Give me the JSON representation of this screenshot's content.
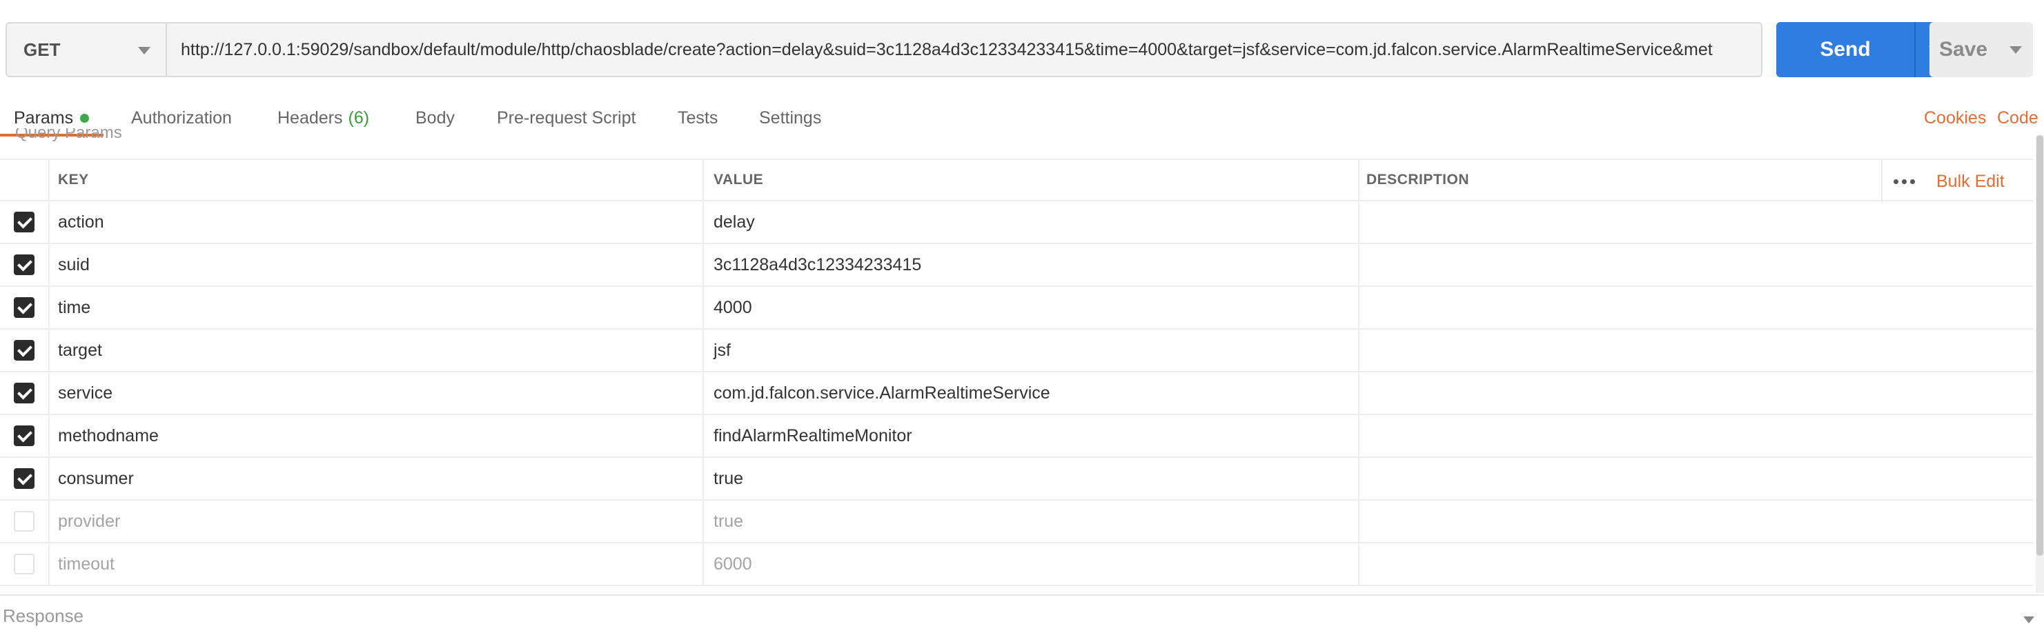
{
  "request": {
    "method": "GET",
    "url": "http://127.0.0.1:59029/sandbox/default/module/http/chaosblade/create?action=delay&suid=3c1128a4d3c12334233415&time=4000&target=jsf&service=com.jd.falcon.service.AlarmRealtimeService&met",
    "send_label": "Send",
    "save_label": "Save"
  },
  "tabs": [
    {
      "label": "Params"
    },
    {
      "label": "Authorization"
    },
    {
      "label": "Headers",
      "count": "(6)"
    },
    {
      "label": "Body"
    },
    {
      "label": "Pre-request Script"
    },
    {
      "label": "Tests"
    },
    {
      "label": "Settings"
    }
  ],
  "links": {
    "cookies": "Cookies",
    "code": "Code"
  },
  "params": {
    "section_label": "Query Params",
    "columns": {
      "key": "KEY",
      "value": "VALUE",
      "description": "DESCRIPTION"
    },
    "bulk_edit_label": "Bulk Edit",
    "rows": [
      {
        "enabled": true,
        "key": "action",
        "value": "delay",
        "description": ""
      },
      {
        "enabled": true,
        "key": "suid",
        "value": "3c1128a4d3c12334233415",
        "description": ""
      },
      {
        "enabled": true,
        "key": "time",
        "value": "4000",
        "description": ""
      },
      {
        "enabled": true,
        "key": "target",
        "value": "jsf",
        "description": ""
      },
      {
        "enabled": true,
        "key": "service",
        "value": "com.jd.falcon.service.AlarmRealtimeService",
        "description": ""
      },
      {
        "enabled": true,
        "key": "methodname",
        "value": "findAlarmRealtimeMonitor",
        "description": ""
      },
      {
        "enabled": true,
        "key": "consumer",
        "value": "true",
        "description": ""
      },
      {
        "enabled": false,
        "key": "provider",
        "value": "true",
        "description": ""
      },
      {
        "enabled": false,
        "key": "timeout",
        "value": "6000",
        "description": ""
      }
    ]
  },
  "response": {
    "label": "Response"
  },
  "colors": {
    "accent": "#e26d32",
    "send": "#2f7de1",
    "active_dot": "#3fa84a"
  }
}
